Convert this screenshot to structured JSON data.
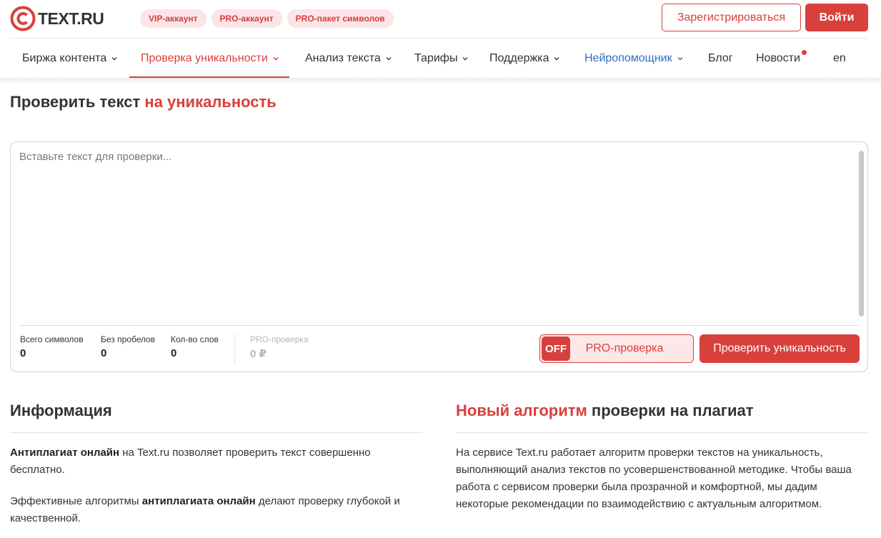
{
  "header": {
    "logo_text": "TEXT.RU",
    "promo": [
      "VIP-аккаунт",
      "PRO-аккаунт",
      "PRO-пакет символов"
    ],
    "register_label": "Зарегистрироваться",
    "login_label": "Войти"
  },
  "nav": {
    "items": [
      {
        "label": "Биржа контента",
        "dropdown": true
      },
      {
        "label": "Проверка уникальности",
        "dropdown": true,
        "active": true
      },
      {
        "label": "Анализ текста",
        "dropdown": true
      },
      {
        "label": "Тарифы",
        "dropdown": true
      },
      {
        "label": "Поддержка",
        "dropdown": true
      },
      {
        "label": "Нейропомощник",
        "dropdown": true,
        "color": "#2f6fbf"
      },
      {
        "label": "Блог",
        "dropdown": false
      },
      {
        "label": "Новости",
        "dropdown": false,
        "notification": true
      },
      {
        "label": "en",
        "dropdown": false
      }
    ]
  },
  "page": {
    "title_part1": "Проверить текст ",
    "title_part2": "на уникальность"
  },
  "editor": {
    "placeholder": "Вставьте текст для проверки...",
    "value": "",
    "stats": [
      {
        "label": "Всего символов",
        "value": "0"
      },
      {
        "label": "Без пробелов",
        "value": "0"
      },
      {
        "label": "Кол-во слов",
        "value": "0"
      },
      {
        "label": "PRO-проверка",
        "value": "0 ₽"
      }
    ],
    "pro_toggle_state": "OFF",
    "pro_toggle_label": "PRO-проверка",
    "check_button_label": "Проверить уникальность"
  },
  "info": {
    "title": "Информация",
    "p1_bold": "Антиплагиат онлайн",
    "p1_rest": " на Text.ru позволяет проверить текст совершенно бесплатно.",
    "p2_start": "Эффективные алгоритмы ",
    "p2_bold": "антиплагиата онлайн",
    "p2_end": " делают проверку глубокой и качественной."
  },
  "algo": {
    "title_accent": "Новый алгоритм",
    "title_rest": " проверки на плагиат",
    "text": "На сервисе Text.ru работает алгоритм проверки текстов на уникальность, выполняющий анализ текстов по усовершенствованной методике. Чтобы ваша работа с сервисом проверки была прозрачной и комфортной, мы дадим некоторые рекомендации по взаимодействию с актуальным алгоритмом."
  },
  "colors": {
    "accent": "#d8403c",
    "pill_bg": "#fbe5e6",
    "link_blue": "#2f6fbf"
  }
}
